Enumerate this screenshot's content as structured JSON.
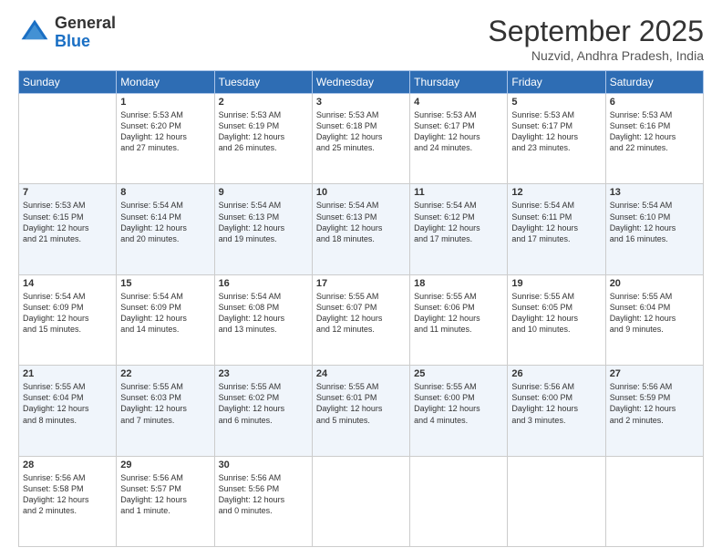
{
  "header": {
    "logo_general": "General",
    "logo_blue": "Blue",
    "month_title": "September 2025",
    "location": "Nuzvid, Andhra Pradesh, India"
  },
  "weekdays": [
    "Sunday",
    "Monday",
    "Tuesday",
    "Wednesday",
    "Thursday",
    "Friday",
    "Saturday"
  ],
  "weeks": [
    [
      {
        "day": "",
        "info": ""
      },
      {
        "day": "1",
        "info": "Sunrise: 5:53 AM\nSunset: 6:20 PM\nDaylight: 12 hours\nand 27 minutes."
      },
      {
        "day": "2",
        "info": "Sunrise: 5:53 AM\nSunset: 6:19 PM\nDaylight: 12 hours\nand 26 minutes."
      },
      {
        "day": "3",
        "info": "Sunrise: 5:53 AM\nSunset: 6:18 PM\nDaylight: 12 hours\nand 25 minutes."
      },
      {
        "day": "4",
        "info": "Sunrise: 5:53 AM\nSunset: 6:17 PM\nDaylight: 12 hours\nand 24 minutes."
      },
      {
        "day": "5",
        "info": "Sunrise: 5:53 AM\nSunset: 6:17 PM\nDaylight: 12 hours\nand 23 minutes."
      },
      {
        "day": "6",
        "info": "Sunrise: 5:53 AM\nSunset: 6:16 PM\nDaylight: 12 hours\nand 22 minutes."
      }
    ],
    [
      {
        "day": "7",
        "info": "Sunrise: 5:53 AM\nSunset: 6:15 PM\nDaylight: 12 hours\nand 21 minutes."
      },
      {
        "day": "8",
        "info": "Sunrise: 5:54 AM\nSunset: 6:14 PM\nDaylight: 12 hours\nand 20 minutes."
      },
      {
        "day": "9",
        "info": "Sunrise: 5:54 AM\nSunset: 6:13 PM\nDaylight: 12 hours\nand 19 minutes."
      },
      {
        "day": "10",
        "info": "Sunrise: 5:54 AM\nSunset: 6:13 PM\nDaylight: 12 hours\nand 18 minutes."
      },
      {
        "day": "11",
        "info": "Sunrise: 5:54 AM\nSunset: 6:12 PM\nDaylight: 12 hours\nand 17 minutes."
      },
      {
        "day": "12",
        "info": "Sunrise: 5:54 AM\nSunset: 6:11 PM\nDaylight: 12 hours\nand 17 minutes."
      },
      {
        "day": "13",
        "info": "Sunrise: 5:54 AM\nSunset: 6:10 PM\nDaylight: 12 hours\nand 16 minutes."
      }
    ],
    [
      {
        "day": "14",
        "info": "Sunrise: 5:54 AM\nSunset: 6:09 PM\nDaylight: 12 hours\nand 15 minutes."
      },
      {
        "day": "15",
        "info": "Sunrise: 5:54 AM\nSunset: 6:09 PM\nDaylight: 12 hours\nand 14 minutes."
      },
      {
        "day": "16",
        "info": "Sunrise: 5:54 AM\nSunset: 6:08 PM\nDaylight: 12 hours\nand 13 minutes."
      },
      {
        "day": "17",
        "info": "Sunrise: 5:55 AM\nSunset: 6:07 PM\nDaylight: 12 hours\nand 12 minutes."
      },
      {
        "day": "18",
        "info": "Sunrise: 5:55 AM\nSunset: 6:06 PM\nDaylight: 12 hours\nand 11 minutes."
      },
      {
        "day": "19",
        "info": "Sunrise: 5:55 AM\nSunset: 6:05 PM\nDaylight: 12 hours\nand 10 minutes."
      },
      {
        "day": "20",
        "info": "Sunrise: 5:55 AM\nSunset: 6:04 PM\nDaylight: 12 hours\nand 9 minutes."
      }
    ],
    [
      {
        "day": "21",
        "info": "Sunrise: 5:55 AM\nSunset: 6:04 PM\nDaylight: 12 hours\nand 8 minutes."
      },
      {
        "day": "22",
        "info": "Sunrise: 5:55 AM\nSunset: 6:03 PM\nDaylight: 12 hours\nand 7 minutes."
      },
      {
        "day": "23",
        "info": "Sunrise: 5:55 AM\nSunset: 6:02 PM\nDaylight: 12 hours\nand 6 minutes."
      },
      {
        "day": "24",
        "info": "Sunrise: 5:55 AM\nSunset: 6:01 PM\nDaylight: 12 hours\nand 5 minutes."
      },
      {
        "day": "25",
        "info": "Sunrise: 5:55 AM\nSunset: 6:00 PM\nDaylight: 12 hours\nand 4 minutes."
      },
      {
        "day": "26",
        "info": "Sunrise: 5:56 AM\nSunset: 6:00 PM\nDaylight: 12 hours\nand 3 minutes."
      },
      {
        "day": "27",
        "info": "Sunrise: 5:56 AM\nSunset: 5:59 PM\nDaylight: 12 hours\nand 2 minutes."
      }
    ],
    [
      {
        "day": "28",
        "info": "Sunrise: 5:56 AM\nSunset: 5:58 PM\nDaylight: 12 hours\nand 2 minutes."
      },
      {
        "day": "29",
        "info": "Sunrise: 5:56 AM\nSunset: 5:57 PM\nDaylight: 12 hours\nand 1 minute."
      },
      {
        "day": "30",
        "info": "Sunrise: 5:56 AM\nSunset: 5:56 PM\nDaylight: 12 hours\nand 0 minutes."
      },
      {
        "day": "",
        "info": ""
      },
      {
        "day": "",
        "info": ""
      },
      {
        "day": "",
        "info": ""
      },
      {
        "day": "",
        "info": ""
      }
    ]
  ]
}
